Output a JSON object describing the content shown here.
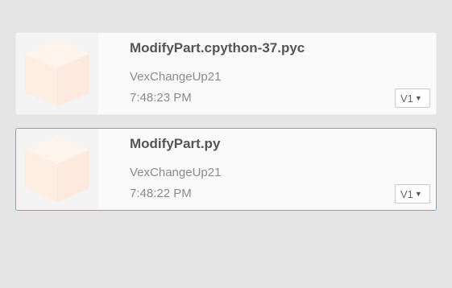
{
  "files": [
    {
      "name": "ModifyPart.cpython-37.pyc",
      "owner": "VexChangeUp21",
      "time": "7:48:23 PM",
      "version": "V1",
      "selected": false
    },
    {
      "name": "ModifyPart.py",
      "owner": "VexChangeUp21",
      "time": "7:48:22 PM",
      "version": "V1",
      "selected": true
    }
  ],
  "icons": {
    "thumbnail": "cube-icon",
    "dropdown": "caret-down-icon"
  },
  "colors": {
    "background": "#e5e5e5",
    "card": "#fafafa",
    "selected_border": "#7d9fd4",
    "cube_fill": "#fdeee3",
    "title_text": "#555555",
    "meta_text": "#8a8a8a"
  }
}
